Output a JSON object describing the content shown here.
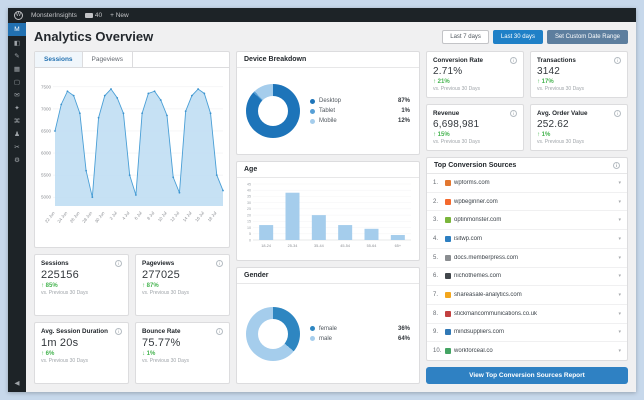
{
  "colors": {
    "accent": "#2271b1",
    "active_range_button": "#1f80c7",
    "custom_range_button": "#5d7e9e",
    "positive_delta": "#46b450",
    "chart_line": "#4a9fd6",
    "chart_fill": "#bcdcf2",
    "admin_dark": "#1d2327"
  },
  "admin_bar": {
    "site": "MonsterInsights",
    "comments": "40",
    "new_item": "+ New"
  },
  "sidebar": {
    "items": [
      {
        "name": "sidebar-item-monsterinsights",
        "glyph": "M",
        "active": true
      },
      {
        "name": "sidebar-item-dashboard",
        "glyph": "◧"
      },
      {
        "name": "sidebar-item-posts",
        "glyph": "✎"
      },
      {
        "name": "sidebar-item-media",
        "glyph": "▦"
      },
      {
        "name": "sidebar-item-pages",
        "glyph": "▢"
      },
      {
        "name": "sidebar-item-comments",
        "glyph": "✉"
      },
      {
        "name": "sidebar-item-appearance",
        "glyph": "✦"
      },
      {
        "name": "sidebar-item-plugins",
        "glyph": "⌘"
      },
      {
        "name": "sidebar-item-users",
        "glyph": "♟"
      },
      {
        "name": "sidebar-item-tools",
        "glyph": "✂"
      },
      {
        "name": "sidebar-item-settings",
        "glyph": "⚙"
      },
      {
        "name": "sidebar-collapse",
        "glyph": "◀",
        "collapse": true
      }
    ]
  },
  "header": {
    "title": "Analytics Overview",
    "range_buttons": [
      "Last 7 days",
      "Last 30 days",
      "Set Custom Date Range"
    ],
    "active_range": "Last 30 days"
  },
  "overview_chart": {
    "type": "area",
    "tabs": [
      "Sessions",
      "Pageviews"
    ],
    "active_tab": "Sessions",
    "y_ticks": [
      5000,
      5500,
      6000,
      6500,
      7000,
      7500
    ],
    "y_range": [
      4800,
      7700
    ],
    "x_labels": [
      "22 Jun",
      "23 Jun",
      "24 Jun",
      "25 Jun",
      "26 Jun",
      "27 Jun",
      "28 Jun",
      "29 Jun",
      "30 Jun",
      "1 Jul",
      "2 Jul",
      "3 Jul",
      "4 Jul",
      "5 Jul",
      "6 Jul",
      "7 Jul",
      "8 Jul",
      "9 Jul",
      "10 Jul",
      "11 Jul",
      "12 Jul",
      "13 Jul",
      "14 Jul",
      "15 Jul",
      "16 Jul",
      "17 Jul",
      "18 Jul",
      "19 Jul"
    ],
    "values": [
      6500,
      7100,
      7400,
      7300,
      6900,
      5600,
      5000,
      6800,
      7300,
      7450,
      7250,
      6900,
      5500,
      5050,
      6900,
      7350,
      7400,
      7200,
      6850,
      5450,
      5100,
      6950,
      7300,
      7450,
      7350,
      6900,
      5500,
      5150
    ]
  },
  "device_breakdown": {
    "title": "Device Breakdown",
    "type": "donut",
    "segments": [
      {
        "label": "Desktop",
        "value": 87,
        "color": "#1d74b9"
      },
      {
        "label": "Tablet",
        "value": 1,
        "color": "#569fd6"
      },
      {
        "label": "Mobile",
        "value": 12,
        "color": "#a5cdec"
      }
    ]
  },
  "age_chart": {
    "title": "Age",
    "type": "bar",
    "categories": [
      "18-24",
      "25-34",
      "35-44",
      "45-54",
      "55-64",
      "65+"
    ],
    "values": [
      12,
      38,
      20,
      12,
      9,
      4
    ],
    "y_ticks": [
      0,
      5,
      10,
      15,
      20,
      25,
      30,
      35,
      40,
      45
    ],
    "bar_color": "#a5cdec"
  },
  "gender_chart": {
    "title": "Gender",
    "type": "donut",
    "segments": [
      {
        "label": "female",
        "value": 36,
        "color": "#2e86c1"
      },
      {
        "label": "male",
        "value": 64,
        "color": "#a5cdec"
      }
    ]
  },
  "left_stats": [
    {
      "label": "Sessions",
      "value": "225156",
      "delta": "85%",
      "direction": "up",
      "sub": "vs. Previous 30 Days"
    },
    {
      "label": "Pageviews",
      "value": "277025",
      "delta": "87%",
      "direction": "up",
      "sub": "vs. Previous 30 Days"
    },
    {
      "label": "Avg. Session Duration",
      "value": "1m 20s",
      "delta": "6%",
      "direction": "up",
      "sub": "vs. Previous 30 Days"
    },
    {
      "label": "Bounce Rate",
      "value": "75.77%",
      "delta": "1%",
      "direction": "down",
      "sub": "vs. Previous 30 Days"
    }
  ],
  "right_stats": [
    {
      "label": "Conversion Rate",
      "value": "2.71%",
      "delta": "21%",
      "direction": "up",
      "sub": "vs. Previous 30 Days"
    },
    {
      "label": "Transactions",
      "value": "3142",
      "delta": "17%",
      "direction": "up",
      "sub": "vs. Previous 30 Days"
    },
    {
      "label": "Revenue",
      "value": "6,698,981",
      "delta": "15%",
      "direction": "up",
      "sub": "vs. Previous 30 Days"
    },
    {
      "label": "Avg. Order Value",
      "value": "252.62",
      "delta": "1%",
      "direction": "up",
      "sub": "vs. Previous 30 Days"
    }
  ],
  "sources": {
    "title": "Top Conversion Sources",
    "button_label": "View Top Conversion Sources Report",
    "items": [
      {
        "rank": "1.",
        "domain": "wpforms.com",
        "favicon_color": "#e27730"
      },
      {
        "rank": "2.",
        "domain": "wpbeginner.com",
        "favicon_color": "#f4692d"
      },
      {
        "rank": "3.",
        "domain": "optinmonster.com",
        "favicon_color": "#7ab53b"
      },
      {
        "rank": "4.",
        "domain": "isitwp.com",
        "favicon_color": "#2d7fc1"
      },
      {
        "rank": "5.",
        "domain": "docs.memberpress.com",
        "favicon_color": "#8a8d90"
      },
      {
        "rank": "6.",
        "domain": "nichothemes.com",
        "favicon_color": "#41464b"
      },
      {
        "rank": "7.",
        "domain": "shareasale-analytics.com",
        "favicon_color": "#f3a61d"
      },
      {
        "rank": "8.",
        "domain": "stickmancommunications.co.uk",
        "favicon_color": "#c24040"
      },
      {
        "rank": "9.",
        "domain": "mindsuppliers.com",
        "favicon_color": "#3178b5"
      },
      {
        "rank": "10.",
        "domain": "workforceal.co",
        "favicon_color": "#44a463"
      }
    ]
  }
}
